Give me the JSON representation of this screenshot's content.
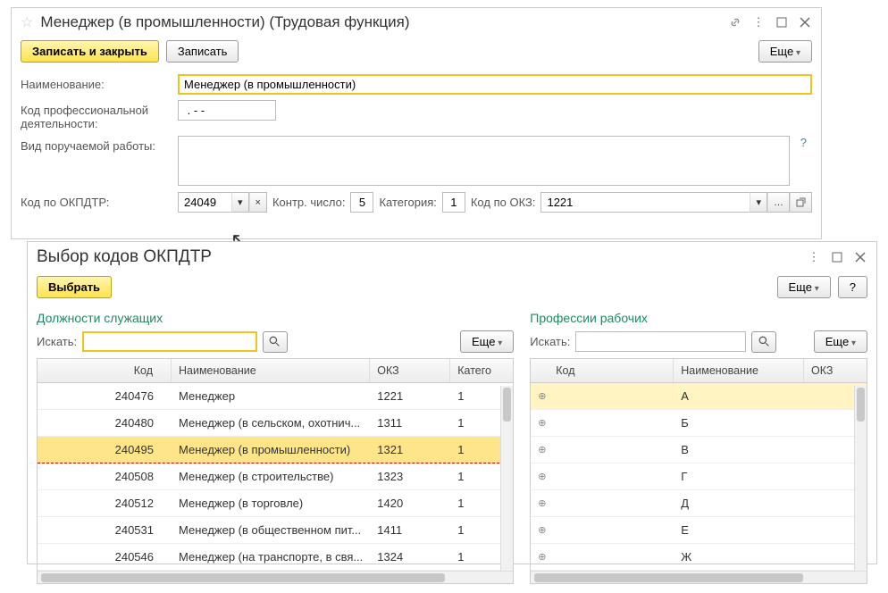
{
  "win1": {
    "title": "Менеджер (в промышленности) (Трудовая функция)",
    "toolbar": {
      "save_close": "Записать и закрыть",
      "save": "Записать",
      "more": "Еще"
    },
    "fields": {
      "name_label": "Наименование:",
      "name_value": "Менеджер (в промышленности)",
      "profcode_label": "Код профессиональной деятельности:",
      "profcode_value": " . - -",
      "worktype_label": "Вид поручаемой работы:",
      "worktype_value": "",
      "okpdtr_label": "Код по ОКПДТР:",
      "okpdtr_value": "24049",
      "check_label": "Контр. число:",
      "check_value": "5",
      "cat_label": "Категория:",
      "cat_value": "1",
      "okz_label": "Код по ОКЗ:",
      "okz_value": "1221"
    }
  },
  "win2": {
    "title": "Выбор кодов ОКПДТР",
    "toolbar": {
      "select": "Выбрать",
      "more": "Еще",
      "help": "?"
    },
    "left": {
      "title": "Должности служащих",
      "search_label": "Искать:",
      "search_value": "",
      "more": "Еще",
      "columns": {
        "code": "Код",
        "name": "Наименование",
        "okz": "ОКЗ",
        "cat": "Катего"
      },
      "rows": [
        {
          "code": "240476",
          "name": "Менеджер",
          "okz": "1221",
          "cat": "1"
        },
        {
          "code": "240480",
          "name": "Менеджер (в сельском, охотнич...",
          "okz": "1311",
          "cat": "1"
        },
        {
          "code": "240495",
          "name": "Менеджер (в промышленности)",
          "okz": "1321",
          "cat": "1",
          "selected": true
        },
        {
          "code": "240508",
          "name": "Менеджер (в строительстве)",
          "okz": "1323",
          "cat": "1"
        },
        {
          "code": "240512",
          "name": "Менеджер (в торговле)",
          "okz": "1420",
          "cat": "1"
        },
        {
          "code": "240531",
          "name": "Менеджер (в общественном пит...",
          "okz": "1411",
          "cat": "1"
        },
        {
          "code": "240546",
          "name": "Менеджер (на транспорте, в свя...",
          "okz": "1324",
          "cat": "1"
        }
      ]
    },
    "right": {
      "title": "Профессии рабочих",
      "search_label": "Искать:",
      "search_value": "",
      "more": "Еще",
      "columns": {
        "code": "Код",
        "name": "Наименование",
        "okz": "ОКЗ"
      },
      "rows": [
        {
          "name": "А",
          "highlight": true
        },
        {
          "name": "Б"
        },
        {
          "name": "В"
        },
        {
          "name": "Г"
        },
        {
          "name": "Д"
        },
        {
          "name": "Е"
        },
        {
          "name": "Ж"
        }
      ]
    }
  }
}
